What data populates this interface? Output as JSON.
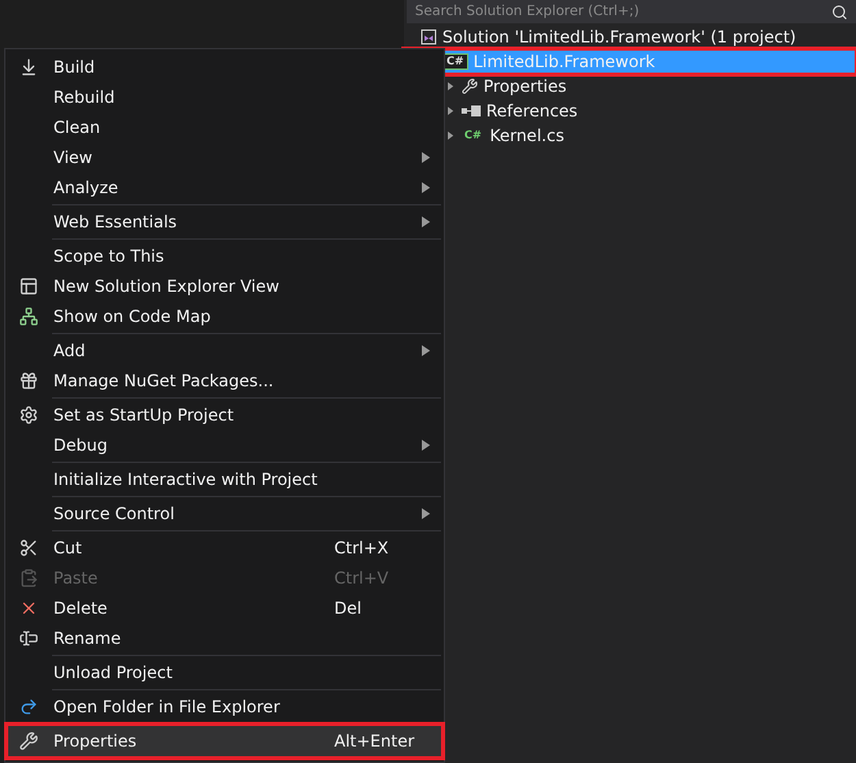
{
  "solution_explorer": {
    "search": {
      "placeholder": "Search Solution Explorer (Ctrl+;)"
    },
    "tree": [
      {
        "label": "Solution 'LimitedLib.Framework' (1 project)",
        "kind": "solution",
        "selected": false,
        "annotated": false,
        "children": [
          {
            "label": "LimitedLib.Framework",
            "kind": "project",
            "badge": "C#",
            "selected": true,
            "annotated": true,
            "children": [
              {
                "label": "Properties",
                "kind": "properties",
                "expanded": false,
                "selected": false,
                "annotated": false
              },
              {
                "label": "References",
                "kind": "references",
                "expanded": false,
                "selected": false,
                "annotated": false
              },
              {
                "label": "Kernel.cs",
                "kind": "file",
                "badge": "C#",
                "expanded": false,
                "selected": false,
                "annotated": false
              }
            ]
          }
        ]
      }
    ]
  },
  "context_menu": {
    "sections": [
      [
        {
          "label": "Build",
          "submenu": false,
          "disabled": false,
          "hovered": false,
          "annotated": false
        },
        {
          "label": "Rebuild",
          "submenu": false,
          "disabled": false,
          "hovered": false,
          "annotated": false
        },
        {
          "label": "Clean",
          "submenu": false,
          "disabled": false,
          "hovered": false,
          "annotated": false
        },
        {
          "label": "View",
          "submenu": true,
          "disabled": false,
          "hovered": false,
          "annotated": false
        },
        {
          "label": "Analyze",
          "submenu": true,
          "disabled": false,
          "hovered": false,
          "annotated": false
        }
      ],
      [
        {
          "label": "Web Essentials",
          "submenu": true,
          "disabled": false,
          "hovered": false,
          "annotated": false
        }
      ],
      [
        {
          "label": "Scope to This",
          "submenu": false,
          "disabled": false,
          "hovered": false,
          "annotated": false
        },
        {
          "label": "New Solution Explorer View",
          "submenu": false,
          "disabled": false,
          "hovered": false,
          "annotated": false
        },
        {
          "label": "Show on Code Map",
          "submenu": false,
          "disabled": false,
          "hovered": false,
          "annotated": false
        }
      ],
      [
        {
          "label": "Add",
          "submenu": true,
          "disabled": false,
          "hovered": false,
          "annotated": false
        },
        {
          "label": "Manage NuGet Packages...",
          "submenu": false,
          "disabled": false,
          "hovered": false,
          "annotated": false
        }
      ],
      [
        {
          "label": "Set as StartUp Project",
          "submenu": false,
          "disabled": false,
          "hovered": false,
          "annotated": false
        },
        {
          "label": "Debug",
          "submenu": true,
          "disabled": false,
          "hovered": false,
          "annotated": false
        }
      ],
      [
        {
          "label": "Initialize Interactive with Project",
          "submenu": false,
          "disabled": false,
          "hovered": false,
          "annotated": false
        }
      ],
      [
        {
          "label": "Source Control",
          "submenu": true,
          "disabled": false,
          "hovered": false,
          "annotated": false
        }
      ],
      [
        {
          "label": "Cut",
          "shortcut": "Ctrl+X",
          "submenu": false,
          "disabled": false,
          "hovered": false,
          "annotated": false
        },
        {
          "label": "Paste",
          "shortcut": "Ctrl+V",
          "submenu": false,
          "disabled": true,
          "hovered": false,
          "annotated": false
        },
        {
          "label": "Delete",
          "shortcut": "Del",
          "submenu": false,
          "disabled": false,
          "hovered": false,
          "annotated": false
        },
        {
          "label": "Rename",
          "submenu": false,
          "disabled": false,
          "hovered": false,
          "annotated": false
        }
      ],
      [
        {
          "label": "Unload Project",
          "submenu": false,
          "disabled": false,
          "hovered": false,
          "annotated": false
        }
      ],
      [
        {
          "label": "Open Folder in File Explorer",
          "submenu": false,
          "disabled": false,
          "hovered": false,
          "annotated": false
        }
      ],
      [
        {
          "label": "Properties",
          "shortcut": "Alt+Enter",
          "submenu": false,
          "disabled": false,
          "hovered": true,
          "annotated": true
        }
      ]
    ]
  }
}
